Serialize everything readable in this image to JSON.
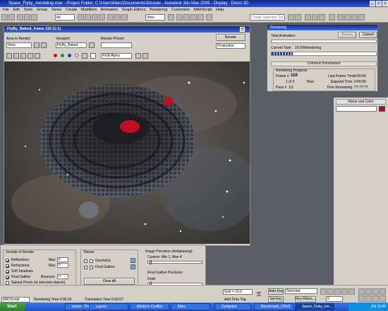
{
  "window": {
    "title": "Space_Flyby_mentalray.max   - Project Folder: C:\\Users\\Marc\\Documents\\3dsmax   - Autodesk 3ds Max  2009   - Display : Direct 3D"
  },
  "menu": [
    "File",
    "Edit",
    "Tools",
    "Group",
    "Views",
    "Create",
    "Modifiers",
    "Animation",
    "Graph Editors",
    "Rendering",
    "Customize",
    "MAXScript",
    "Help"
  ],
  "toolbar": {
    "filter_value": "All",
    "view_value": "View",
    "selection_set_placeholder": "Create Selection Set"
  },
  "frame_window": {
    "title": "FlyBy_Baked, frame 110 (1:1)",
    "area_label": "Area to Render:",
    "area_value": "View",
    "viewport_label": "Viewport:",
    "viewport_value": "FlyBy_Baked",
    "preset_label": "Render Preset:",
    "preset_value": "",
    "render_button": "Render",
    "production_value": "Production",
    "channel_value": "RGB Alpha"
  },
  "render_settings": {
    "include_title": "Include in Render",
    "reflections": "Reflections:",
    "refractions": "Refractions:",
    "soft_shadows": "Soft Shadows",
    "final_gather": "Final Gather",
    "subset_pixels": "Subset Pixels (of selected objects)",
    "max_label": "Max",
    "bounces_label": "Bounces",
    "reflections_max": "6",
    "refractions_max": "6",
    "bounces_value": "0",
    "reuse_title": "Reuse",
    "geometry": "Geometry",
    "final_gather_reuse": "Final Gather",
    "clear_all": "Clear All",
    "image_precision_title": "Image Precision (Antialiasing):",
    "image_precision_value": "Custom: Min 1, Max 4",
    "fg_precision_title": "Final Gather Precision:",
    "fg_precision_value": "Draft"
  },
  "rendering_dialog": {
    "title": "Rendering",
    "total_animation": "Total Animation:",
    "pause": "Pause",
    "cancel": "Cancel",
    "current_task_label": "Current Task:",
    "current_task_percent": "19.5%",
    "current_task_text": "Rendering",
    "progress": 0.2,
    "common_params": "Common Parameters",
    "progress_group": "Rendering Progress",
    "frame_label": "Frame #",
    "frame_value": "110",
    "frame_of": "1 of 2",
    "total_label": "Total",
    "pass_label": "Pass #",
    "pass_value": "1/1",
    "last_frame_time": "Last Frame Time:",
    "last_frame_value": "0:00:00",
    "elapsed_time": "Elapsed Time:",
    "elapsed_value": "0:00:00",
    "time_remaining": "Time Remaining:",
    "time_remaining_value": "??:??:??"
  },
  "command_panel": {
    "name_and_color": "Name and Color"
  },
  "status": {
    "maxscript": "MAXScript",
    "rendering_time": "Rendering Time 0:00:10",
    "translation_time": "Translation Time 0:00:07",
    "grid": "Grid = 10,0",
    "add_time_tag": "Add Time Tag",
    "auto_key": "Auto Key",
    "set_key": "Set Key",
    "selected": "Selected",
    "key_filters": "Key Filters...",
    "frame_counter": "0"
  },
  "taskbar": {
    "start": "Start",
    "items": [
      "winrar - Paint",
      "Layers",
      "World in Conflict",
      "Marc",
      "Computer",
      "Benchmark_CPU2",
      "Space_Flyby_me..."
    ],
    "language": "EN",
    "clock": "16:45"
  },
  "colors": {
    "title_blue": "#0b2a8a",
    "progress_blue": "#1c3fb8",
    "object_color": "#a0102a"
  }
}
